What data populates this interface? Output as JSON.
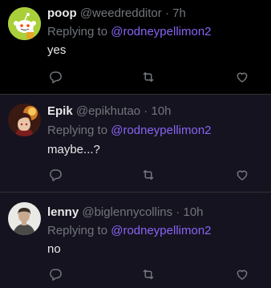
{
  "colors": {
    "accent": "#8a63f5",
    "muted": "#71767b",
    "text": "#e7e9ea",
    "highlight_bg": "#15131f"
  },
  "replies": [
    {
      "display_name": "poop",
      "handle": "@weedredditor",
      "separator": " · ",
      "time": "7h",
      "replying_prefix": "Replying to ",
      "replying_to": "@rodneypellimon2",
      "text": "yes",
      "avatar": "reddit-snoo-avatar"
    },
    {
      "display_name": "Epik",
      "handle": "@epikhutao",
      "separator": " · ",
      "time": "10h",
      "replying_prefix": "Replying to ",
      "replying_to": "@rodneypellimon2",
      "text": "maybe...?",
      "avatar": "anime-character-avatar"
    },
    {
      "display_name": "lenny",
      "handle": "@biglennycollins",
      "separator": " · ",
      "time": "10h",
      "replying_prefix": "Replying to ",
      "replying_to": "@rodneypellimon2",
      "text": "no",
      "avatar": "person-photo-avatar"
    }
  ],
  "action_icons": [
    "reply-icon",
    "retweet-icon",
    "like-icon"
  ]
}
